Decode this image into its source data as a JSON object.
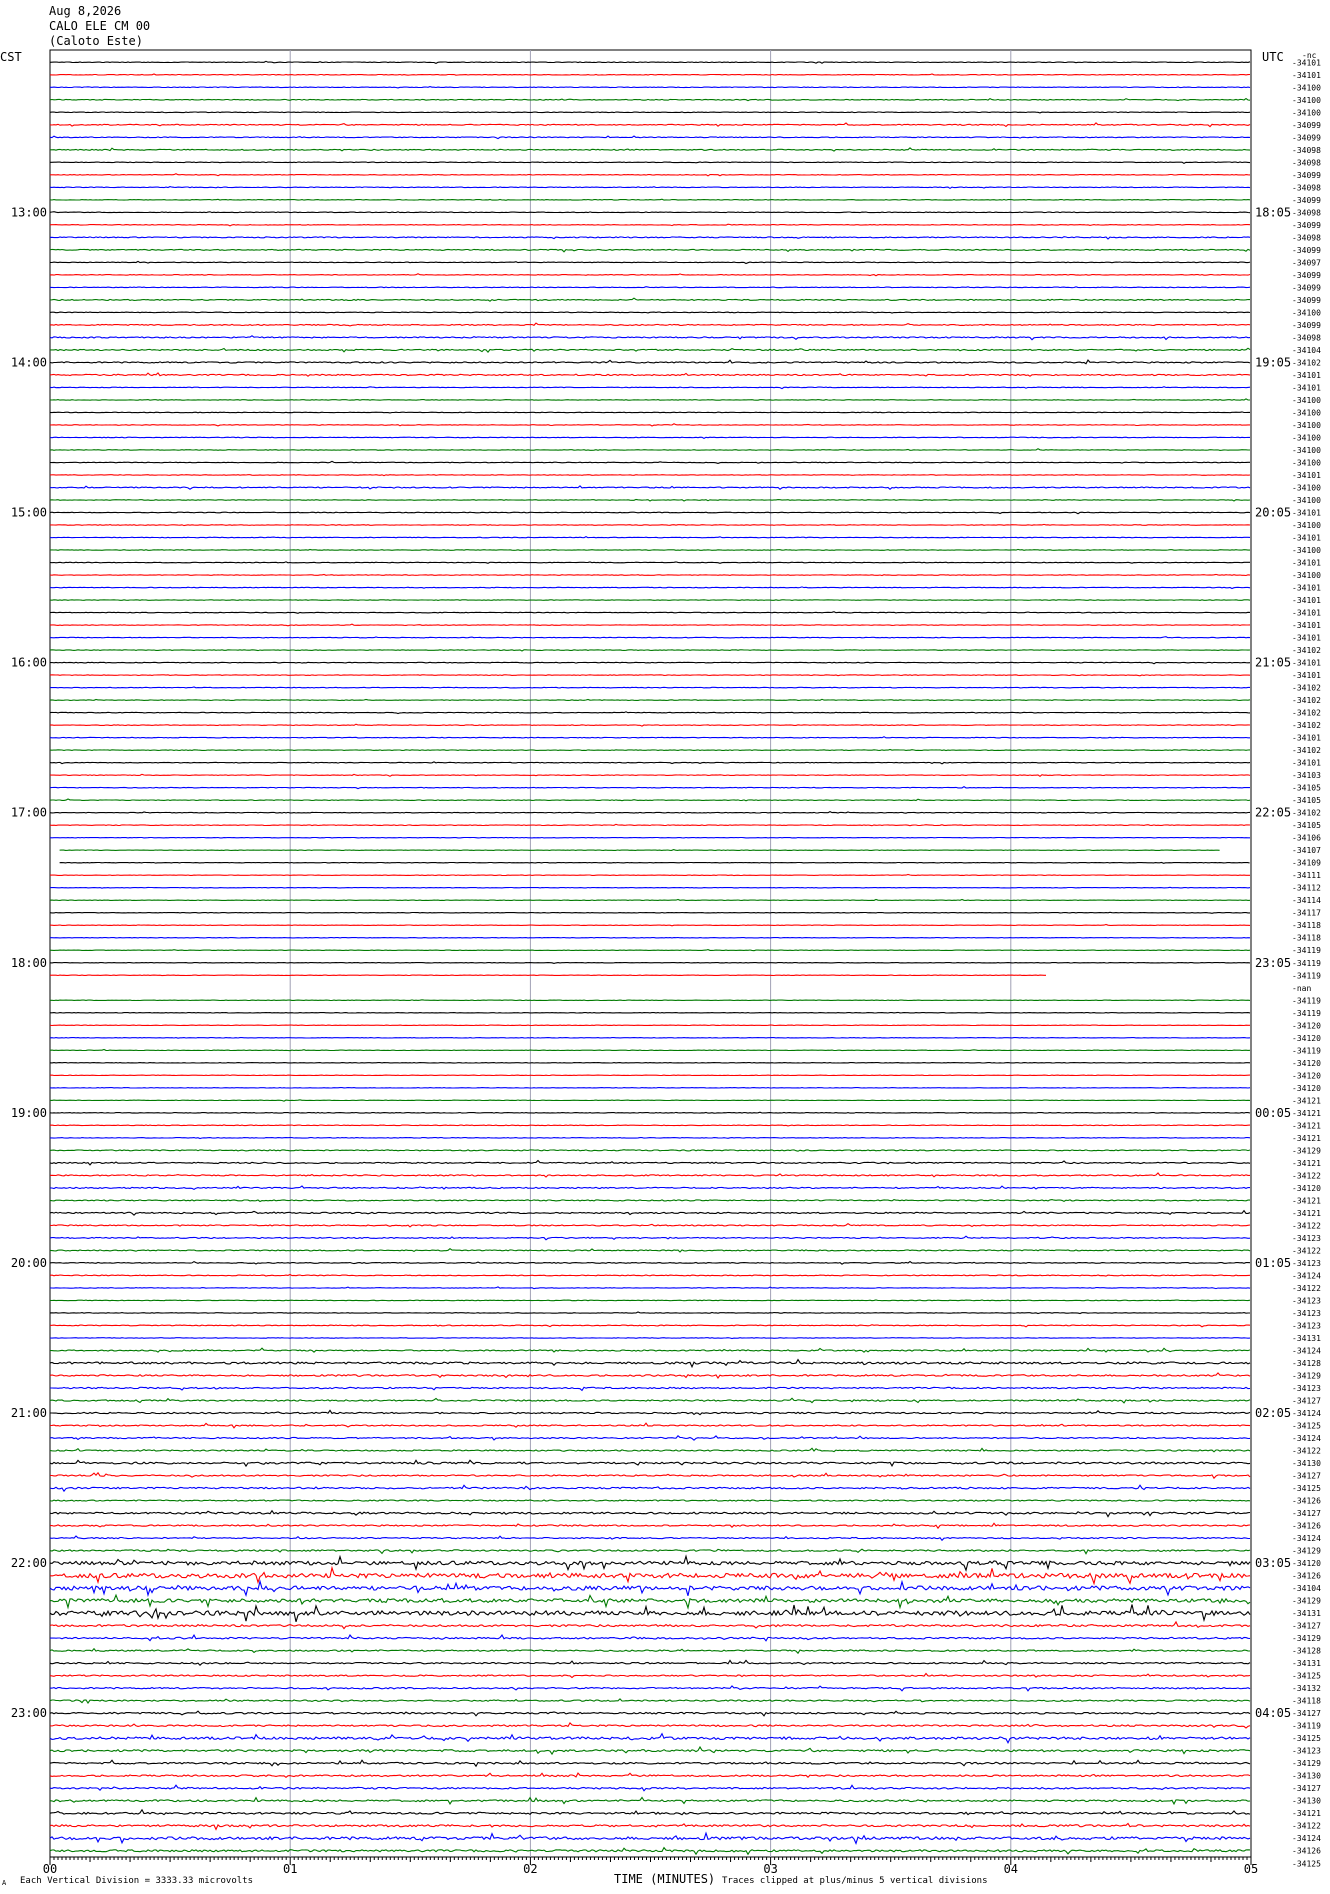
{
  "header": {
    "date": "Aug 8,2026",
    "station": "CALO ELE CM 00",
    "location": "(Caloto Este)",
    "left_tz": "CST",
    "right_tz": "UTC",
    "right_top_label": "-nc"
  },
  "footer": {
    "division_note": "Each Vertical Division = 3333.33 microvolts",
    "xlabel": "TIME (MINUTES)",
    "clip_note": "Traces clipped at plus/minus 5 vertical divisions",
    "corner_mark": "A"
  },
  "colors": {
    "black": "#000000",
    "red": "#ff0000",
    "blue": "#0000ff",
    "green": "#007a00",
    "grid": "#a0a0b4"
  },
  "chart_data": {
    "type": "line",
    "description_type": "helicorder",
    "x_ticks": [
      "00",
      "01",
      "02",
      "03",
      "04",
      "05"
    ],
    "xlim": [
      0,
      5
    ],
    "trace_count": 144,
    "trace_color_cycle": [
      "black",
      "red",
      "blue",
      "green"
    ],
    "left_time_labels": [
      "13:00",
      "14:00",
      "15:00",
      "16:00",
      "17:00",
      "18:00",
      "19:00",
      "20:00",
      "21:00",
      "22:00",
      "23:00"
    ],
    "right_time_labels": [
      "18:05",
      "19:05",
      "20:05",
      "21:05",
      "22:05",
      "23:05",
      "00:05",
      "01:05",
      "02:05",
      "03:05",
      "04:05"
    ],
    "hour_label_trace_indices": [
      12,
      24,
      36,
      48,
      60,
      72,
      84,
      96,
      108,
      120,
      132
    ],
    "right_values": [
      "-34101",
      "-34101",
      "-34100",
      "-34100",
      "-34100",
      "-34099",
      "-34099",
      "-34098",
      "-34098",
      "-34099",
      "-34098",
      "-34099",
      "-34098",
      "-34099",
      "-34098",
      "-34099",
      "-34097",
      "-34099",
      "-34099",
      "-34099",
      "-34100",
      "-34099",
      "-34098",
      "-34104",
      "-34102",
      "-34101",
      "-34101",
      "-34100",
      "-34100",
      "-34100",
      "-34100",
      "-34100",
      "-34100",
      "-34101",
      "-34100",
      "-34100",
      "-34101",
      "-34100",
      "-34101",
      "-34100",
      "-34101",
      "-34100",
      "-34101",
      "-34101",
      "-34101",
      "-34101",
      "-34101",
      "-34102",
      "-34101",
      "-34101",
      "-34102",
      "-34102",
      "-34102",
      "-34102",
      "-34101",
      "-34102",
      "-34101",
      "-34103",
      "-34105",
      "-34105",
      "-34102",
      "-34105",
      "-34106",
      "-34107",
      "-34109",
      "-34111",
      "-34112",
      "-34114",
      "-34117",
      "-34118",
      "-34118",
      "-34119",
      "-34119",
      "-34119",
      "-nan",
      "-34119",
      "-34119",
      "-34120",
      "-34120",
      "-34119",
      "-34120",
      "-34120",
      "-34120",
      "-34121",
      "-34121",
      "-34121",
      "-34121",
      "-34129",
      "-34121",
      "-34122",
      "-34120",
      "-34121",
      "-34121",
      "-34122",
      "-34123",
      "-34122",
      "-34123",
      "-34124",
      "-34122",
      "-34123",
      "-34123",
      "-34123",
      "-34131",
      "-34124",
      "-34128",
      "-34129",
      "-34123",
      "-34127",
      "-34124",
      "-34125",
      "-34124",
      "-34122",
      "-34130",
      "-34127",
      "-34125",
      "-34126",
      "-34127",
      "-34126",
      "-34124",
      "-34129",
      "-34120",
      "-34126",
      "-34104",
      "-34129",
      "-34131",
      "-34127",
      "-34129",
      "-34128",
      "-34131",
      "-34125",
      "-34132",
      "-34118",
      "-34127",
      "-34119",
      "-34125",
      "-34123",
      "-34129",
      "-34130",
      "-34127",
      "-34130",
      "-34121",
      "-34122",
      "-34124",
      "-34126",
      "-34125"
    ],
    "series_activity": [
      0.3,
      0.3,
      0.3,
      0.4,
      0.3,
      0.5,
      0.4,
      0.5,
      0.3,
      0.3,
      0.3,
      0.3,
      0.3,
      0.3,
      0.5,
      0.5,
      0.3,
      0.3,
      0.3,
      0.5,
      0.3,
      0.5,
      0.6,
      0.6,
      0.6,
      0.6,
      0.3,
      0.3,
      0.3,
      0.3,
      0.3,
      0.3,
      0.3,
      0.3,
      0.5,
      0.3,
      0.3,
      0.3,
      0.3,
      0.3,
      0.3,
      0.3,
      0.3,
      0.3,
      0.3,
      0.3,
      0.3,
      0.3,
      0.3,
      0.3,
      0.3,
      0.3,
      0.3,
      0.3,
      0.3,
      0.3,
      0.3,
      0.3,
      0.3,
      0.3,
      0.3,
      0.3,
      0.2,
      0.2,
      0.2,
      0.2,
      0.2,
      0.2,
      0.2,
      0.2,
      0.2,
      0.2,
      0.2,
      0.2,
      0.0,
      0.2,
      0.2,
      0.2,
      0.2,
      0.2,
      0.2,
      0.2,
      0.2,
      0.2,
      0.3,
      0.3,
      0.3,
      0.5,
      0.6,
      0.6,
      0.6,
      0.5,
      0.6,
      0.5,
      0.5,
      0.5,
      0.4,
      0.4,
      0.3,
      0.3,
      0.3,
      0.4,
      0.3,
      0.6,
      1.0,
      0.8,
      0.7,
      0.7,
      0.7,
      0.6,
      0.6,
      0.6,
      0.9,
      0.7,
      0.8,
      0.6,
      0.9,
      0.7,
      0.6,
      0.8,
      1.8,
      2.2,
      2.0,
      1.8,
      2.2,
      1.0,
      0.8,
      0.7,
      0.7,
      0.7,
      0.7,
      0.7,
      0.8,
      0.8,
      1.2,
      1.0,
      0.8,
      0.8,
      0.8,
      0.9,
      0.9,
      1.0,
      1.4,
      1.0,
      1.5
    ],
    "special_trace_spans": [
      {
        "trace": 63,
        "x_start": 0.04,
        "x_end": 4.87
      },
      {
        "trace": 64,
        "x_start": 0.04,
        "x_end": 5.0
      },
      {
        "trace": 73,
        "x_start": 0.0,
        "x_end": 4.15
      },
      {
        "trace": 74,
        "x_start": 0.0,
        "x_end": 0.0
      }
    ]
  }
}
